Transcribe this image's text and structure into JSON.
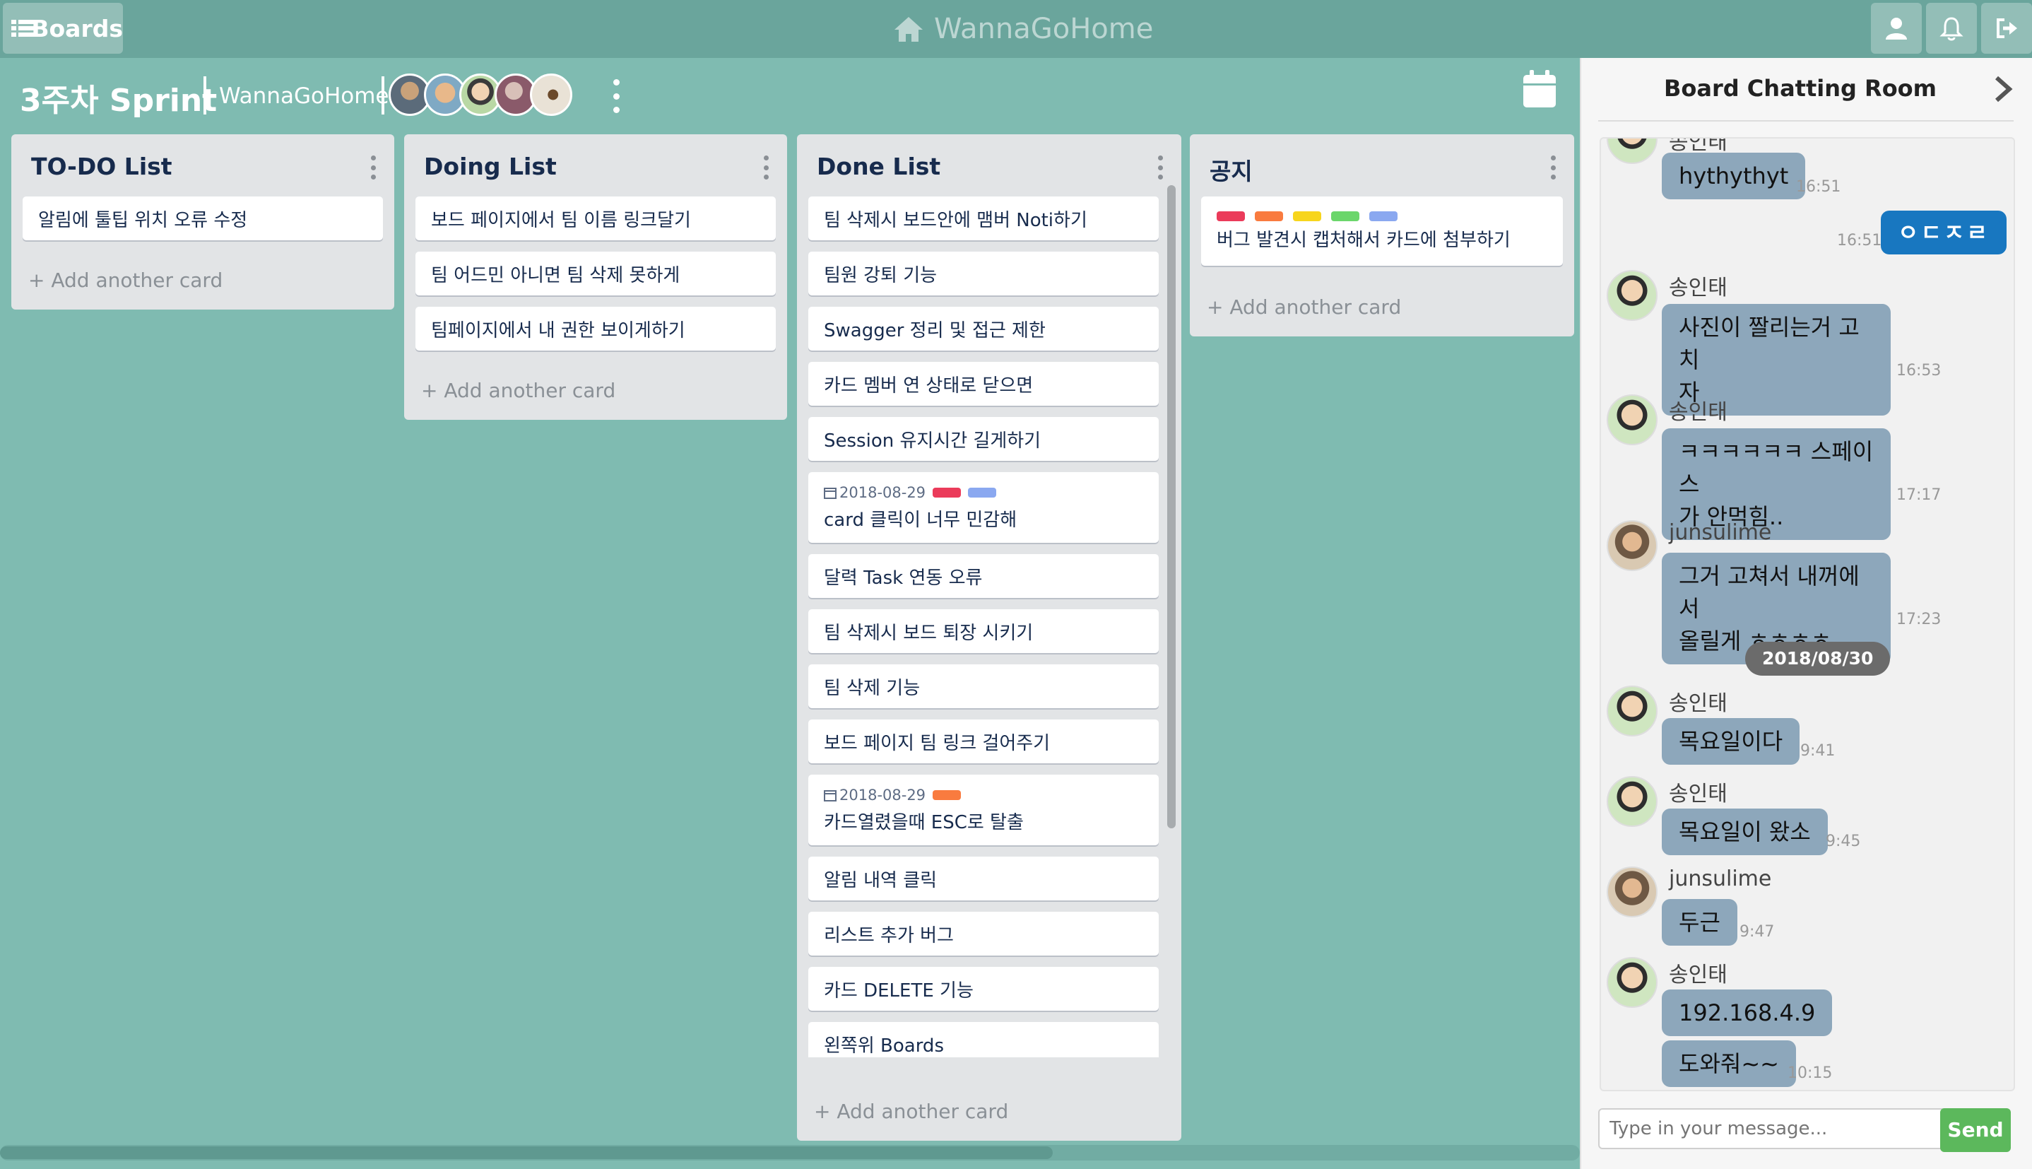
{
  "nav": {
    "boards_label": "Boards",
    "brand": "WannaGoHome"
  },
  "board": {
    "title": "3주차 Sprint",
    "team": "WannaGoHome"
  },
  "lists": [
    {
      "title": "TO-DO List",
      "cards": [
        {
          "text": "알림에 툴팁 위치 오류 수정"
        }
      ],
      "add_label": "+ Add another card"
    },
    {
      "title": "Doing List",
      "cards": [
        {
          "text": "보드 페이지에서 팀 이름 링크달기"
        },
        {
          "text": "팀 어드민 아니면 팀 삭제 못하게"
        },
        {
          "text": "팀페이지에서 내 권한 보이게하기"
        }
      ],
      "add_label": "+ Add another card"
    },
    {
      "title": "Done List",
      "cards": [
        {
          "text": "팀 삭제시 보드안에 맴버 Noti하기"
        },
        {
          "text": "팀원 강퇴 기능"
        },
        {
          "text": "Swagger 정리 및 접근 제한"
        },
        {
          "text": "카드 멤버 연 상태로 닫으면"
        },
        {
          "text": "Session 유지시간 길게하기"
        },
        {
          "text": "card 클릭이 너무 민감해",
          "date": "2018-08-29",
          "labels": [
            "#eb3b5a",
            "#8aa8f0"
          ]
        },
        {
          "text": "달력 Task 연동 오류"
        },
        {
          "text": "팀 삭제시 보드 퇴장 시키기"
        },
        {
          "text": "팀 삭제 기능"
        },
        {
          "text": "보드 페이지 팀 링크 걸어주기"
        },
        {
          "text": "카드열렸을때 ESC로 탈출",
          "date": "2018-08-29",
          "labels": [
            "#f97b3f"
          ]
        },
        {
          "text": "알림 내역 클릭"
        },
        {
          "text": "리스트 추가 버그"
        },
        {
          "text": "카드 DELETE 기능"
        },
        {
          "text": "왼쪽위 Boards"
        }
      ],
      "add_label": "+ Add another card"
    },
    {
      "title": "공지",
      "cards": [
        {
          "text": "버그 발견시 캡처해서 카드에 첨부하기",
          "labels": [
            "#eb3b5a",
            "#f97b3f",
            "#f7d51d",
            "#6bd66b",
            "#8aa8f0"
          ]
        }
      ],
      "add_label": "+ Add another card"
    }
  ],
  "chat": {
    "title": "Board Chatting Room",
    "messages": [
      {
        "name": "송인태",
        "lines": [
          "hythythyt"
        ],
        "time": "16:51"
      },
      {
        "mine": true,
        "lines": [
          "ㅇㄷㅈㄹ"
        ],
        "time": "16:51"
      },
      {
        "name": "송인태",
        "lines": [
          "사진이 짤리는거 고치",
          "자"
        ],
        "time": "16:53"
      },
      {
        "name": "송인태",
        "lines": [
          "ㅋㅋㅋㅋㅋㅋ 스페이스",
          "가 안먹힘.."
        ],
        "time": "17:17"
      },
      {
        "name": "junsulime",
        "lines": [
          "그거 고쳐서 내꺼에서",
          "올릴게 ㅎㅎㅎㅎ"
        ],
        "time": "17:23"
      },
      {
        "date": "2018/08/30"
      },
      {
        "name": "송인태",
        "lines": [
          "목요일이다"
        ],
        "time": "9:41"
      },
      {
        "name": "송인태",
        "lines": [
          "목요일이 왔소"
        ],
        "time": "9:45"
      },
      {
        "name": "junsulime",
        "lines": [
          "두근"
        ],
        "time": "9:47"
      },
      {
        "name": "송인태",
        "lines": [
          "192.168.4.9"
        ],
        "time": ""
      },
      {
        "lines": [
          "도와줘~~"
        ],
        "time": "10:15"
      }
    ],
    "input_placeholder": "Type in your message...",
    "send_label": "Send"
  }
}
